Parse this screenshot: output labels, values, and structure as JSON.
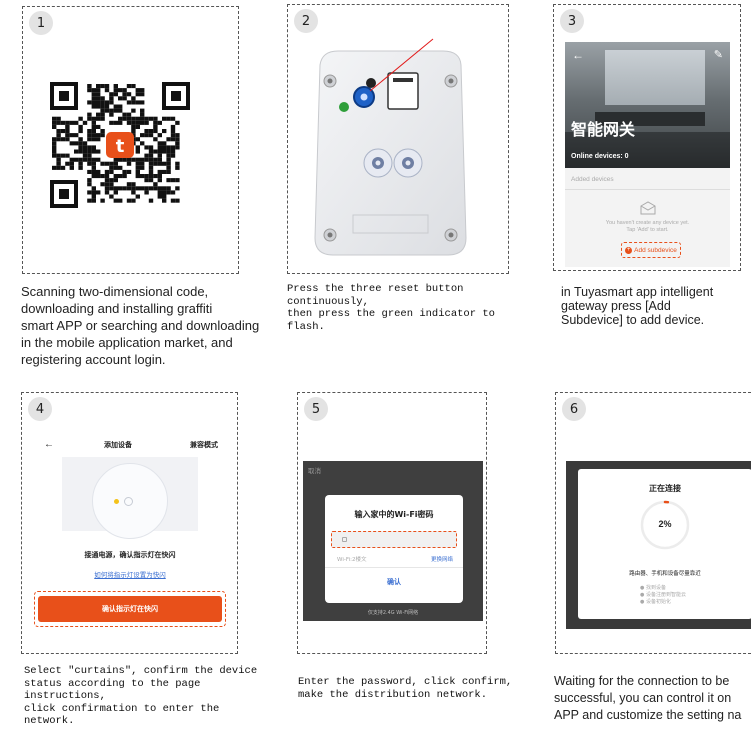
{
  "steps": [
    {
      "number": "1",
      "caption_lines": [
        "Scanning two-dimensional code,",
        "downloading and installing graffiti",
        "smart APP or searching and downloading",
        "in the mobile application market, and",
        "registering account login."
      ]
    },
    {
      "number": "2",
      "caption_lines": [
        "Press the three reset button continuously,",
        "then press the green indicator to flash."
      ]
    },
    {
      "number": "3",
      "caption_lines": [
        "in Tuyasmart app intelligent",
        "gateway press [Add",
        "Subdevice] to add device."
      ],
      "screen": {
        "title": "智能网关",
        "online": "Online devices: 0",
        "added": "Added devices",
        "empty_line1": "You haven't create any device yet.",
        "empty_line2": "Tap 'Add' to start.",
        "add_button": "Add subdevice"
      }
    },
    {
      "number": "4",
      "caption_lines": [
        "Select \"curtains\", confirm the device",
        "status according to the page instructions,",
        "click confirmation to enter the network."
      ],
      "screen": {
        "back": "←",
        "title": "添加设备",
        "mode": "兼容模式",
        "instruction": "接通电源，确认指示灯在快闪",
        "help_link": "如何将指示灯设置为快闪",
        "confirm_button": "确认指示灯在快闪"
      }
    },
    {
      "number": "5",
      "caption_lines": [
        "Enter the password, click confirm,",
        "make the distribution network."
      ],
      "screen": {
        "cancel": "取消",
        "dialog_title": "输入家中的Wi-Fi密码",
        "wifi_label": "Wi-Fi:2楼文",
        "change_network": "更换网络",
        "confirm": "确认",
        "footer": "仅支持2.4G Wi-Fi网络"
      }
    },
    {
      "number": "6",
      "caption_lines": [
        "Waiting for the connection to be",
        "successful, you can control it on",
        "APP and customize the setting na"
      ],
      "screen": {
        "title": "正在连接",
        "percent": "2%",
        "hint": "路由器、手机和设备尽量靠近",
        "steps": [
          "找到设备",
          "设备注册到智能云",
          "设备初始化"
        ]
      },
      "progress": 0.02
    }
  ],
  "colors": {
    "accent": "#e8501a",
    "green": "#2e9e3a",
    "blue": "#1f62c7",
    "link": "#3b6fd1"
  }
}
